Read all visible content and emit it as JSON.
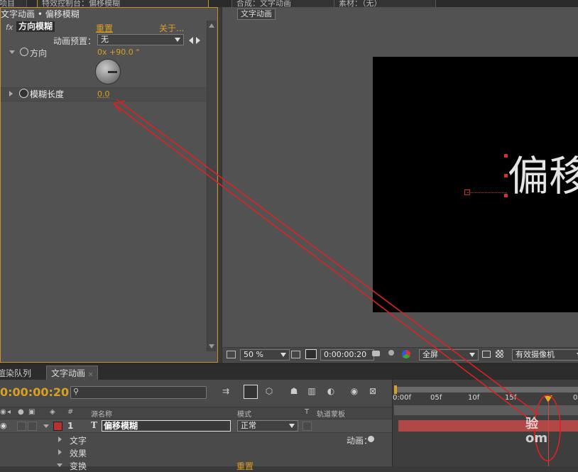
{
  "top_tabs": {
    "left_fragment": "项目",
    "effect_controls_tab": "特效控制台：偏移模糊",
    "preview_tab": "合成：文字动画",
    "footage_tab": "素材：（无）"
  },
  "effect_controls": {
    "breadcrumb": "文字动画 • 偏移模糊",
    "fx_badge": "fx",
    "effect_name": "方向模糊",
    "reset_label": "重置",
    "about_label": "关于...",
    "preset_label": "动画预置：",
    "preset_value": "无",
    "direction_label": "方向",
    "direction_value": "0x +90.0 °",
    "blur_length_label": "模糊长度",
    "blur_length_value": "0.0"
  },
  "composition": {
    "tab_label": "文字动画",
    "canvas_text": "偏移",
    "toolbar": {
      "zoom": "50 %",
      "timecode": "0:00:00:20",
      "resolution": "全屏",
      "camera": "有效摄像机"
    }
  },
  "timeline": {
    "render_queue_tab": "渲染队列",
    "comp_tab": "文字动画",
    "current_time": "0:00:00:20",
    "search_placeholder": "",
    "columns": {
      "hash": "#",
      "source_name": "源名称",
      "mode": "模式",
      "t": "T",
      "track_matte": "轨道蒙板"
    },
    "layer": {
      "index": "1",
      "type_glyph": "T",
      "name": "偏移模糊",
      "mode": "正常"
    },
    "sub_rows": [
      {
        "label": "文字",
        "extra": "动画："
      },
      {
        "label": "效果",
        "extra": ""
      },
      {
        "label": "变换",
        "extra": "重置"
      }
    ],
    "ruler_ticks": [
      "0:00f",
      "05f",
      "10f",
      "15f",
      "0"
    ]
  },
  "watermark_text": "验\nom",
  "colors": {
    "accent_orange": "#d8a022",
    "annotation_red": "#dd2222",
    "layer_bar": "#b04848"
  }
}
